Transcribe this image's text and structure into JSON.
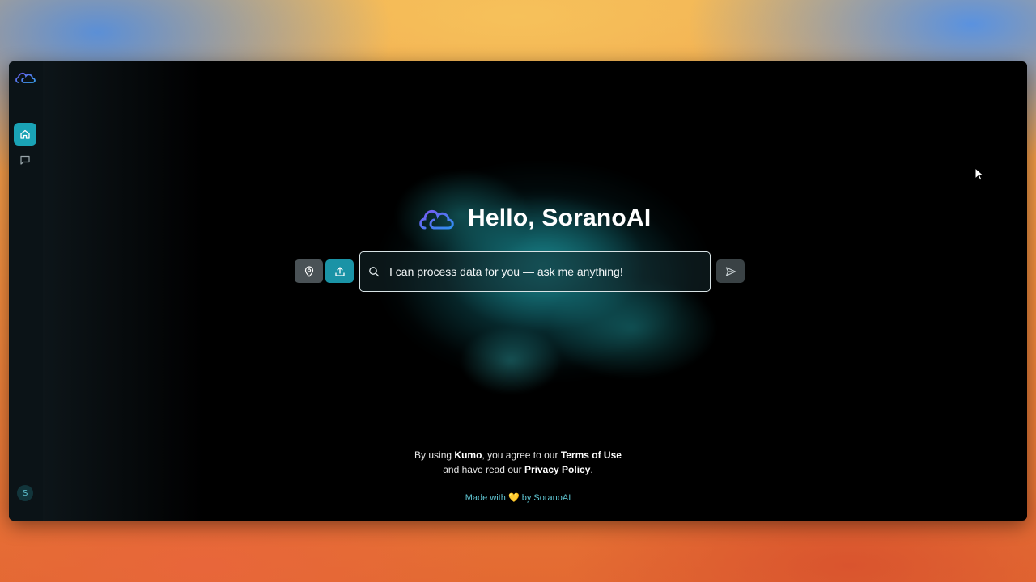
{
  "sidebar": {
    "logo_icon": "cloud-logo-icon",
    "items": [
      {
        "icon": "home-icon",
        "active": true
      },
      {
        "icon": "chat-icon",
        "active": false
      }
    ],
    "avatar_initial": "S"
  },
  "hero": {
    "logo_icon": "cloud-logo-icon",
    "title": "Hello, SoranoAI"
  },
  "input_bar": {
    "location_icon": "location-pin-icon",
    "upload_icon": "upload-icon",
    "search_icon": "search-icon",
    "placeholder": "I can process data for you — ask me anything!",
    "value": "",
    "send_icon": "send-icon"
  },
  "footer": {
    "prefix": "By using ",
    "brand": "Kumo",
    "middle": ", you agree to our ",
    "terms_link": "Terms of Use",
    "line2_prefix": "and have read our ",
    "privacy_link": "Privacy Policy",
    "line2_suffix": ".",
    "made_prefix": "Made with ",
    "heart": "💛",
    "made_suffix": " by SoranoAI"
  },
  "colors": {
    "accent": "#1aa3b6",
    "sidebar_bg": "#0b1317",
    "background": "#000000",
    "smoke": "#20aab2"
  }
}
